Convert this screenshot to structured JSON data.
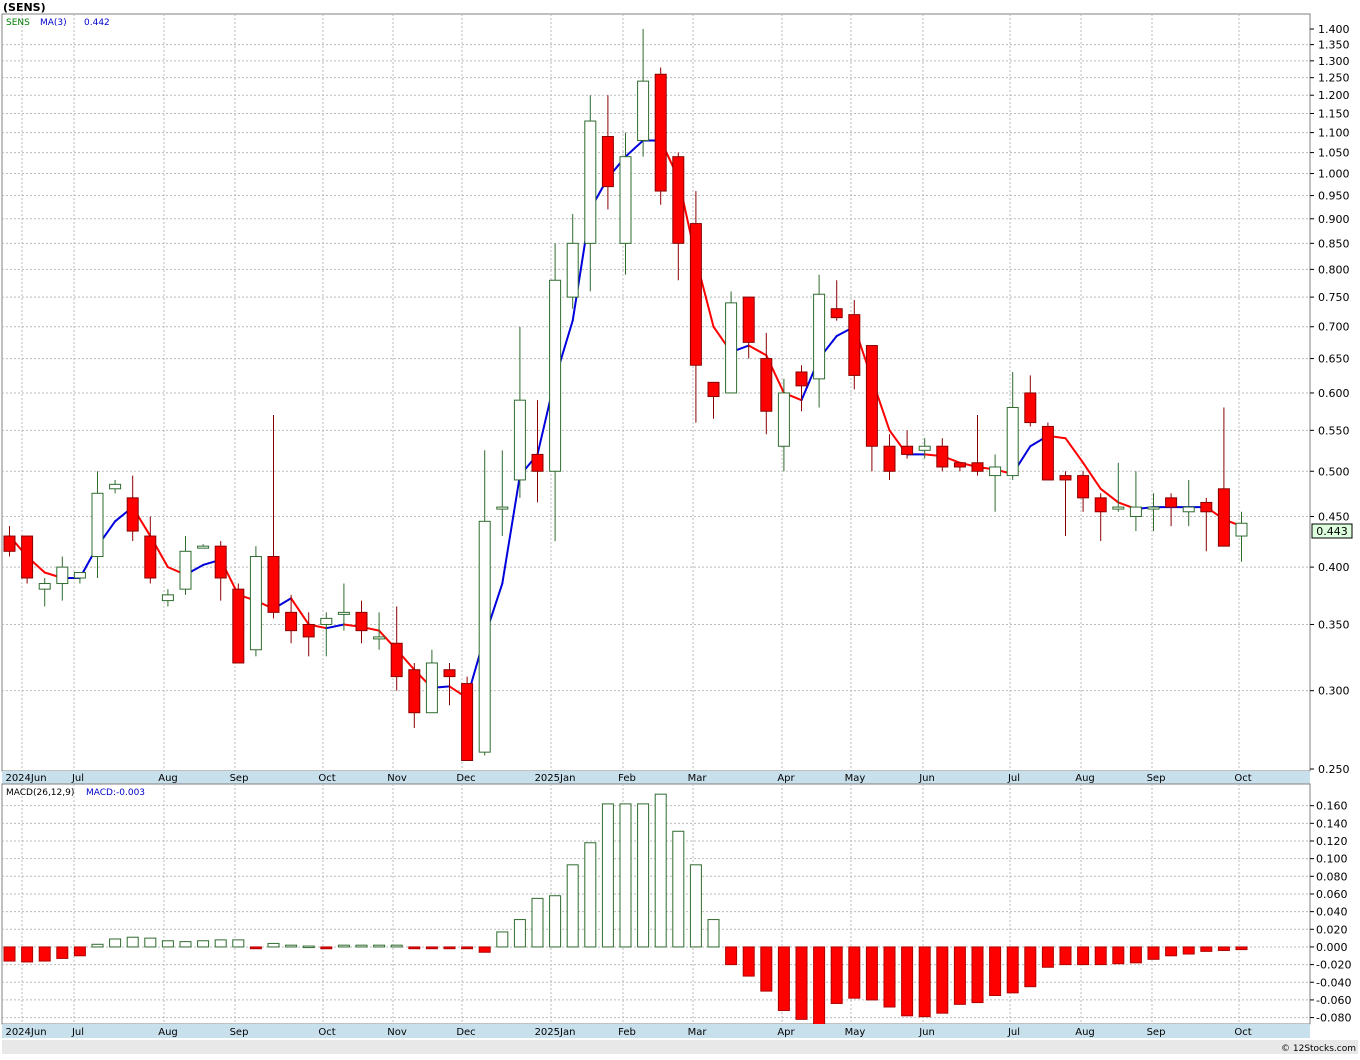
{
  "header": {
    "symbol_title": "(SENS)",
    "legend_symbol": "SENS",
    "legend_ma": "MA(3)",
    "legend_ma_value": "0.442",
    "macd_label": "MACD(26,12,9)",
    "macd_value_label": "MACD:-0.003",
    "last_price_tag": "0.443",
    "footer": "© 12Stocks.com"
  },
  "colors": {
    "up_candle_fill": "#ffffff",
    "up_candle_stroke": "#2f6b2f",
    "down_candle_fill": "#ff0000",
    "down_candle_stroke": "#8b0000",
    "ma_up": "#0000dd",
    "ma_down": "#ff0000",
    "macd_pos_stroke": "#2f6b2f",
    "macd_neg_fill": "#ff0000",
    "grid": "#bbbbbb",
    "axis_band": "#c8e0ec",
    "legend_green": "#008000",
    "legend_blue": "#0000cc",
    "price_tag_bg": "#ddffdd"
  },
  "chart_data": [
    {
      "type": "candlestick",
      "title": "(SENS)",
      "frequency": "weekly",
      "y_scale": "log",
      "ylim": [
        0.25,
        1.4
      ],
      "y_ticks": [
        "1.400",
        "1.350",
        "1.300",
        "1.250",
        "1.200",
        "1.150",
        "1.100",
        "1.050",
        "1.000",
        "0.950",
        "0.900",
        "0.850",
        "0.800",
        "0.750",
        "0.700",
        "0.650",
        "0.600",
        "0.550",
        "0.500",
        "0.450",
        "0.400",
        "0.350",
        "0.300",
        "0.250"
      ],
      "x_month_labels": [
        "2024Jun",
        "Jul",
        "Aug",
        "Sep",
        "Oct",
        "Nov",
        "Dec",
        "2025Jan",
        "Feb",
        "Mar",
        "Apr",
        "May",
        "Jun",
        "Jul",
        "Aug",
        "Sep",
        "Oct"
      ],
      "grid": true,
      "candles": [
        [
          0.43,
          0.44,
          0.41,
          0.415
        ],
        [
          0.43,
          0.43,
          0.385,
          0.39
        ],
        [
          0.38,
          0.39,
          0.365,
          0.385
        ],
        [
          0.385,
          0.41,
          0.37,
          0.4
        ],
        [
          0.39,
          0.395,
          0.385,
          0.395
        ],
        [
          0.41,
          0.5,
          0.39,
          0.475
        ],
        [
          0.48,
          0.49,
          0.475,
          0.485
        ],
        [
          0.47,
          0.495,
          0.425,
          0.435
        ],
        [
          0.43,
          0.45,
          0.385,
          0.39
        ],
        [
          0.37,
          0.38,
          0.365,
          0.375
        ],
        [
          0.38,
          0.43,
          0.375,
          0.415
        ],
        [
          0.42,
          0.422,
          0.418,
          0.42
        ],
        [
          0.42,
          0.425,
          0.37,
          0.39
        ],
        [
          0.38,
          0.385,
          0.32,
          0.32
        ],
        [
          0.33,
          0.42,
          0.325,
          0.41
        ],
        [
          0.41,
          0.57,
          0.355,
          0.36
        ],
        [
          0.36,
          0.375,
          0.335,
          0.345
        ],
        [
          0.35,
          0.36,
          0.325,
          0.34
        ],
        [
          0.35,
          0.36,
          0.325,
          0.355
        ],
        [
          0.36,
          0.385,
          0.345,
          0.36
        ],
        [
          0.36,
          0.37,
          0.335,
          0.345
        ],
        [
          0.34,
          0.36,
          0.33,
          0.34
        ],
        [
          0.335,
          0.365,
          0.3,
          0.31
        ],
        [
          0.315,
          0.32,
          0.275,
          0.285
        ],
        [
          0.285,
          0.33,
          0.285,
          0.32
        ],
        [
          0.315,
          0.32,
          0.29,
          0.31
        ],
        [
          0.305,
          0.31,
          0.255,
          0.255
        ],
        [
          0.26,
          0.525,
          0.258,
          0.445
        ],
        [
          0.46,
          0.525,
          0.43,
          0.46
        ],
        [
          0.49,
          0.7,
          0.47,
          0.59
        ],
        [
          0.52,
          0.59,
          0.465,
          0.5
        ],
        [
          0.5,
          0.85,
          0.425,
          0.78
        ],
        [
          0.75,
          0.91,
          0.73,
          0.85
        ],
        [
          0.85,
          1.2,
          0.76,
          1.13
        ],
        [
          1.09,
          1.2,
          0.92,
          0.97
        ],
        [
          0.85,
          1.1,
          0.79,
          1.04
        ],
        [
          1.08,
          1.4,
          1.04,
          1.24
        ],
        [
          1.26,
          1.28,
          0.93,
          0.96
        ],
        [
          1.04,
          1.05,
          0.78,
          0.85
        ],
        [
          0.89,
          0.96,
          0.56,
          0.64
        ],
        [
          0.615,
          0.615,
          0.565,
          0.595
        ],
        [
          0.6,
          0.76,
          0.6,
          0.74
        ],
        [
          0.75,
          0.75,
          0.65,
          0.675
        ],
        [
          0.65,
          0.69,
          0.545,
          0.575
        ],
        [
          0.53,
          0.62,
          0.5,
          0.6
        ],
        [
          0.63,
          0.64,
          0.575,
          0.61
        ],
        [
          0.62,
          0.79,
          0.58,
          0.755
        ],
        [
          0.73,
          0.78,
          0.71,
          0.715
        ],
        [
          0.72,
          0.745,
          0.605,
          0.625
        ],
        [
          0.67,
          0.67,
          0.5,
          0.53
        ],
        [
          0.53,
          0.545,
          0.49,
          0.5
        ],
        [
          0.53,
          0.55,
          0.515,
          0.52
        ],
        [
          0.525,
          0.54,
          0.515,
          0.53
        ],
        [
          0.53,
          0.54,
          0.5,
          0.505
        ],
        [
          0.51,
          0.51,
          0.5,
          0.505
        ],
        [
          0.51,
          0.57,
          0.495,
          0.5
        ],
        [
          0.495,
          0.52,
          0.455,
          0.505
        ],
        [
          0.495,
          0.63,
          0.49,
          0.58
        ],
        [
          0.6,
          0.625,
          0.555,
          0.56
        ],
        [
          0.555,
          0.56,
          0.5,
          0.49
        ],
        [
          0.495,
          0.5,
          0.43,
          0.49
        ],
        [
          0.495,
          0.5,
          0.455,
          0.47
        ],
        [
          0.47,
          0.475,
          0.425,
          0.455
        ],
        [
          0.46,
          0.51,
          0.455,
          0.46
        ],
        [
          0.45,
          0.5,
          0.435,
          0.46
        ],
        [
          0.46,
          0.475,
          0.435,
          0.46
        ],
        [
          0.47,
          0.475,
          0.44,
          0.46
        ],
        [
          0.455,
          0.49,
          0.44,
          0.46
        ],
        [
          0.465,
          0.47,
          0.415,
          0.455
        ],
        [
          0.48,
          0.58,
          0.42,
          0.42
        ],
        [
          0.43,
          0.455,
          0.405,
          0.443
        ]
      ],
      "ma3": [
        0.43,
        0.41,
        0.395,
        0.39,
        0.39,
        0.42,
        0.445,
        0.46,
        0.43,
        0.4,
        0.393,
        0.402,
        0.407,
        0.375,
        0.37,
        0.363,
        0.372,
        0.35,
        0.347,
        0.35,
        0.348,
        0.345,
        0.33,
        0.315,
        0.302,
        0.303,
        0.295,
        0.34,
        0.385,
        0.495,
        0.52,
        0.62,
        0.71,
        0.92,
        0.99,
        1.04,
        1.08,
        1.08,
        0.99,
        0.82,
        0.7,
        0.66,
        0.67,
        0.655,
        0.6,
        0.59,
        0.65,
        0.685,
        0.7,
        0.62,
        0.55,
        0.52,
        0.52,
        0.518,
        0.51,
        0.505,
        0.502,
        0.497,
        0.53,
        0.543,
        0.54,
        0.51,
        0.48,
        0.465,
        0.458,
        0.46,
        0.46,
        0.46,
        0.46,
        0.447,
        0.44
      ],
      "ma3_current": 0.442,
      "last_price": 0.443
    },
    {
      "type": "bar",
      "title": "MACD(26,12,9)",
      "current_value": -0.003,
      "ylim": [
        -0.085,
        0.18
      ],
      "y_ticks": [
        "0.160",
        "0.140",
        "0.120",
        "0.100",
        "0.080",
        "0.060",
        "0.040",
        "0.020",
        "0.000",
        "-0.020",
        "-0.040",
        "-0.060",
        "-0.080"
      ],
      "x_month_labels": [
        "2024Jun",
        "Jul",
        "Aug",
        "Sep",
        "Oct",
        "Nov",
        "Dec",
        "2025Jan",
        "Feb",
        "Mar",
        "Apr",
        "May",
        "Jun",
        "Jul",
        "Aug",
        "Sep",
        "Oct"
      ],
      "values": [
        -0.016,
        -0.017,
        -0.016,
        -0.013,
        -0.01,
        0.003,
        0.009,
        0.011,
        0.01,
        0.007,
        0.006,
        0.007,
        0.008,
        0.008,
        -0.002,
        0.004,
        0.002,
        0.001,
        -0.002,
        0.002,
        0.002,
        0.002,
        0.002,
        -0.002,
        -0.002,
        -0.002,
        -0.002,
        -0.006,
        0.017,
        0.031,
        0.055,
        0.058,
        0.093,
        0.118,
        0.162,
        0.162,
        0.162,
        0.173,
        0.131,
        0.093,
        0.031,
        -0.02,
        -0.033,
        -0.05,
        -0.072,
        -0.082,
        -0.09,
        -0.064,
        -0.058,
        -0.06,
        -0.068,
        -0.078,
        -0.079,
        -0.075,
        -0.065,
        -0.063,
        -0.055,
        -0.052,
        -0.045,
        -0.023,
        -0.02,
        -0.02,
        -0.02,
        -0.019,
        -0.018,
        -0.014,
        -0.01,
        -0.008,
        -0.005,
        -0.004,
        -0.003
      ]
    }
  ]
}
